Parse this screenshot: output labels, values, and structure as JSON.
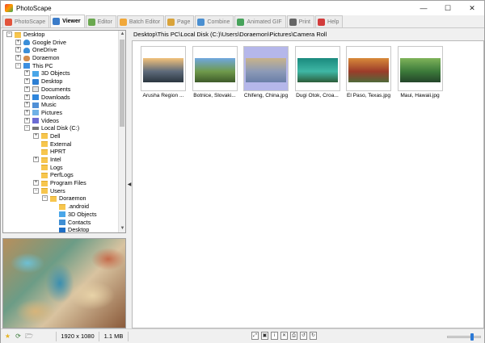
{
  "window": {
    "title": "PhotoScape",
    "controls": {
      "minimize": "—",
      "maximize": "☐",
      "close": "✕"
    }
  },
  "tabs": [
    {
      "label": "PhotoScape",
      "icon": "photoscape-icon",
      "color": "#e2543c",
      "active": false
    },
    {
      "label": "Viewer",
      "icon": "viewer-icon",
      "color": "#3b7cc9",
      "active": true
    },
    {
      "label": "Editor",
      "icon": "editor-icon",
      "color": "#6aa84f",
      "active": false
    },
    {
      "label": "Batch Editor",
      "icon": "batch-editor-icon",
      "color": "#f1a83a",
      "active": false
    },
    {
      "label": "Page",
      "icon": "page-icon",
      "color": "#d9a33a",
      "active": false
    },
    {
      "label": "Combine",
      "icon": "combine-icon",
      "color": "#4a8fd1",
      "active": false
    },
    {
      "label": "Animated GIF",
      "icon": "animated-gif-icon",
      "color": "#47a35b",
      "active": false
    },
    {
      "label": "Print",
      "icon": "print-icon",
      "color": "#666666",
      "active": false
    },
    {
      "label": "Help",
      "icon": "help-icon",
      "color": "#d23b3b",
      "active": false
    }
  ],
  "tree": [
    {
      "label": "Desktop",
      "indent": 0,
      "expander": "−",
      "icon": "folder"
    },
    {
      "label": "Google Drive",
      "indent": 1,
      "expander": "+",
      "icon": "cloud"
    },
    {
      "label": "OneDrive",
      "indent": 1,
      "expander": "+",
      "icon": "cloud"
    },
    {
      "label": "Doraemon",
      "indent": 1,
      "expander": "+",
      "icon": "person"
    },
    {
      "label": "This PC",
      "indent": 1,
      "expander": "−",
      "icon": "pc"
    },
    {
      "label": "3D Objects",
      "indent": 2,
      "expander": "+",
      "icon": "cube"
    },
    {
      "label": "Desktop",
      "indent": 2,
      "expander": "+",
      "icon": "blue"
    },
    {
      "label": "Documents",
      "indent": 2,
      "expander": "+",
      "icon": "doc"
    },
    {
      "label": "Downloads",
      "indent": 2,
      "expander": "+",
      "icon": "down"
    },
    {
      "label": "Music",
      "indent": 2,
      "expander": "+",
      "icon": "music"
    },
    {
      "label": "Pictures",
      "indent": 2,
      "expander": "+",
      "icon": "pic"
    },
    {
      "label": "Videos",
      "indent": 2,
      "expander": "+",
      "icon": "vid"
    },
    {
      "label": "Local Disk (C:)",
      "indent": 2,
      "expander": "−",
      "icon": "disk"
    },
    {
      "label": "Dell",
      "indent": 3,
      "expander": "+",
      "icon": "folder"
    },
    {
      "label": "External",
      "indent": 3,
      "expander": "",
      "icon": "folder"
    },
    {
      "label": "HPRT",
      "indent": 3,
      "expander": "",
      "icon": "folder"
    },
    {
      "label": "Intel",
      "indent": 3,
      "expander": "+",
      "icon": "folder"
    },
    {
      "label": "Logs",
      "indent": 3,
      "expander": "",
      "icon": "folder"
    },
    {
      "label": "PerfLogs",
      "indent": 3,
      "expander": "",
      "icon": "folder"
    },
    {
      "label": "Program Files",
      "indent": 3,
      "expander": "+",
      "icon": "folder"
    },
    {
      "label": "Users",
      "indent": 3,
      "expander": "−",
      "icon": "folder"
    },
    {
      "label": "Doraemon",
      "indent": 4,
      "expander": "−",
      "icon": "folder"
    },
    {
      "label": ".android",
      "indent": 5,
      "expander": "",
      "icon": "folder"
    },
    {
      "label": "3D Objects",
      "indent": 5,
      "expander": "",
      "icon": "cube"
    },
    {
      "label": "Contacts",
      "indent": 5,
      "expander": "",
      "icon": "contacts"
    },
    {
      "label": "Desktop",
      "indent": 5,
      "expander": "",
      "icon": "desk"
    }
  ],
  "scrollbar": {
    "up": "▲",
    "down": "▼"
  },
  "splitter": {
    "grip": "◀"
  },
  "path": "Desktop\\This PC\\Local Disk (C:)\\Users\\Doraemon\\Pictures\\Camera Roll",
  "thumbnails": [
    {
      "caption": "Arusha Region ...",
      "colors": [
        "#f3c27a",
        "#5d6a7a",
        "#2b3640"
      ],
      "selected": false
    },
    {
      "caption": "Botnice, Slovaki...",
      "colors": [
        "#6fa7e0",
        "#6f9a4b",
        "#3e5b2a"
      ],
      "selected": false
    },
    {
      "caption": "Chifeng, China.jpg",
      "colors": [
        "#c9b38a",
        "#8c9ab7",
        "#6a7fa8"
      ],
      "selected": true
    },
    {
      "caption": "Dugi Otok, Croa...",
      "colors": [
        "#1a8a7e",
        "#3fb7a5",
        "#2c5d3a"
      ],
      "selected": false
    },
    {
      "caption": "El Paso, Texas.jpg",
      "colors": [
        "#d88a3a",
        "#9c3c2a",
        "#4f6a3a"
      ],
      "selected": false
    },
    {
      "caption": "Maui, Hawaii.jpg",
      "colors": [
        "#7fb35a",
        "#3c7a3a",
        "#24452a"
      ],
      "selected": false
    }
  ],
  "status": {
    "icons": [
      {
        "name": "favorite-icon",
        "glyph": "★",
        "color": "#e6b422"
      },
      {
        "name": "refresh-icon",
        "glyph": "⟳",
        "color": "#3a7a3a"
      },
      {
        "name": "folder-open-icon",
        "glyph": "🗁",
        "color": "#555555"
      }
    ],
    "resolution": "1920 x 1080",
    "filesize": "1.1 MB",
    "tools": [
      {
        "name": "fit-screen-icon",
        "glyph": "⤢"
      },
      {
        "name": "full-screen-icon",
        "glyph": "▣"
      },
      {
        "name": "info-icon",
        "glyph": "i"
      },
      {
        "name": "delete-icon",
        "glyph": "✕"
      },
      {
        "name": "print-tool-icon",
        "glyph": "⎙"
      },
      {
        "name": "rotate-left-icon",
        "glyph": "↺"
      },
      {
        "name": "rotate-right-icon",
        "glyph": "↻"
      }
    ]
  }
}
